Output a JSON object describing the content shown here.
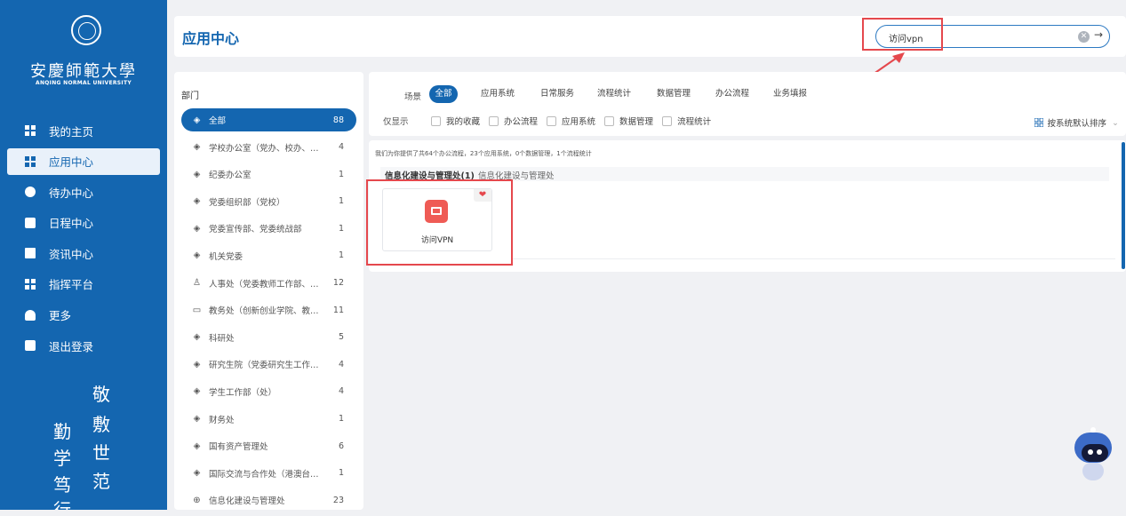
{
  "colors": {
    "primary": "#1466b0",
    "highlight": "#e5484d",
    "app_icon": "#ef5b55"
  },
  "sidebar": {
    "logo_cn": "安慶師範大學",
    "logo_en": "ANQING NORMAL UNIVERSITY",
    "items": [
      {
        "label": "我的主页",
        "icon": "grid-icon"
      },
      {
        "label": "应用中心",
        "icon": "grid-icon",
        "active": true
      },
      {
        "label": "待办中心",
        "icon": "compass-icon"
      },
      {
        "label": "日程中心",
        "icon": "calendar-icon"
      },
      {
        "label": "资讯中心",
        "icon": "news-icon"
      },
      {
        "label": "指挥平台",
        "icon": "grid-icon"
      },
      {
        "label": "更多",
        "icon": "home-icon"
      },
      {
        "label": "退出登录",
        "icon": "logout-icon"
      }
    ],
    "motto": [
      "敬",
      "勤",
      "敷",
      "学",
      "世",
      "笃",
      "范",
      "行"
    ]
  },
  "header": {
    "title": "应用中心",
    "search": {
      "value": "访问vpn"
    }
  },
  "departments": {
    "title": "部门",
    "items": [
      {
        "label": "全部",
        "count": "88",
        "active": true,
        "icon": "layers-icon"
      },
      {
        "label": "学校办公室（党办、校办、…",
        "count": "4",
        "icon": "layers-icon"
      },
      {
        "label": "纪委办公室",
        "count": "1",
        "icon": "layers-icon"
      },
      {
        "label": "党委组织部（党校）",
        "count": "1",
        "icon": "layers-icon"
      },
      {
        "label": "党委宣传部、党委统战部",
        "count": "1",
        "icon": "layers-icon"
      },
      {
        "label": "机关党委",
        "count": "1",
        "icon": "layers-icon"
      },
      {
        "label": "人事处（党委教师工作部、…",
        "count": "12",
        "icon": "person-icon"
      },
      {
        "label": "教务处（创新创业学院、教…",
        "count": "11",
        "icon": "book-icon"
      },
      {
        "label": "科研处",
        "count": "5",
        "icon": "layers-icon"
      },
      {
        "label": "研究生院（党委研究生工作…",
        "count": "4",
        "icon": "layers-icon"
      },
      {
        "label": "学生工作部（处）",
        "count": "4",
        "icon": "layers-icon"
      },
      {
        "label": "财务处",
        "count": "1",
        "icon": "layers-icon"
      },
      {
        "label": "国有资产管理处",
        "count": "6",
        "icon": "layers-icon"
      },
      {
        "label": "国际交流与合作处（港澳台…",
        "count": "1",
        "icon": "layers-icon"
      },
      {
        "label": "信息化建设与管理处",
        "count": "23",
        "icon": "globe-icon"
      }
    ]
  },
  "filters": {
    "scene_label": "场景",
    "scenes": [
      "全部",
      "应用系统",
      "日常服务",
      "流程统计",
      "数据管理",
      "办公流程",
      "业务填报"
    ],
    "only_label": "仅显示",
    "only_options": [
      "我的收藏",
      "办公流程",
      "应用系统",
      "数据管理",
      "流程统计"
    ],
    "sort_label": "按系统默认排序"
  },
  "results": {
    "summary": "我们为你提供了共64个办公流程，23个应用系统，0个数据管理，1个流程统计",
    "group_title": "信息化建设与管理处(1)",
    "group_sub": "信息化建设与管理处",
    "apps": [
      {
        "name": "访问VPN",
        "favorited": true
      }
    ]
  }
}
